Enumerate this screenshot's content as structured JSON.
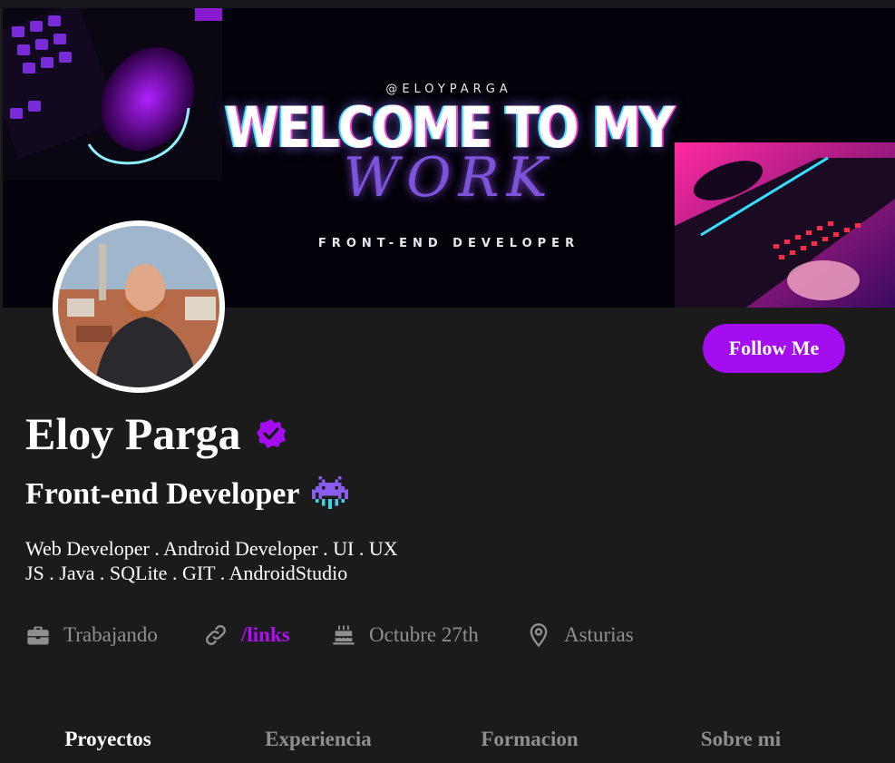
{
  "banner": {
    "handle": "@ELOYPARGA",
    "title": "WELCOME TO MY",
    "script": "WORK",
    "subtitle": "FRONT-END DEVELOPER"
  },
  "profile": {
    "name": "Eloy Parga",
    "role": "Front-end Developer",
    "bio_lines": [
      "Web Developer . Android Developer . UI . UX",
      "JS . Java . SQLite . GIT . AndroidStudio"
    ],
    "follow_label": "Follow Me"
  },
  "meta": {
    "status": {
      "icon": "briefcase-icon",
      "text": "Trabajando"
    },
    "link": {
      "icon": "link-icon",
      "text": "/links"
    },
    "birthday": {
      "icon": "cake-icon",
      "text": "Octubre 27th"
    },
    "location": {
      "icon": "location-pin-icon",
      "text": "Asturias"
    }
  },
  "tabs": [
    {
      "label": "Proyectos",
      "active": true
    },
    {
      "label": "Experiencia",
      "active": false
    },
    {
      "label": "Formacion",
      "active": false
    },
    {
      "label": "Sobre mi",
      "active": false
    }
  ],
  "colors": {
    "accent": "#a30df0",
    "background": "#1b1b1b",
    "muted_text": "#8f8f8f",
    "link": "#b00ef6"
  }
}
